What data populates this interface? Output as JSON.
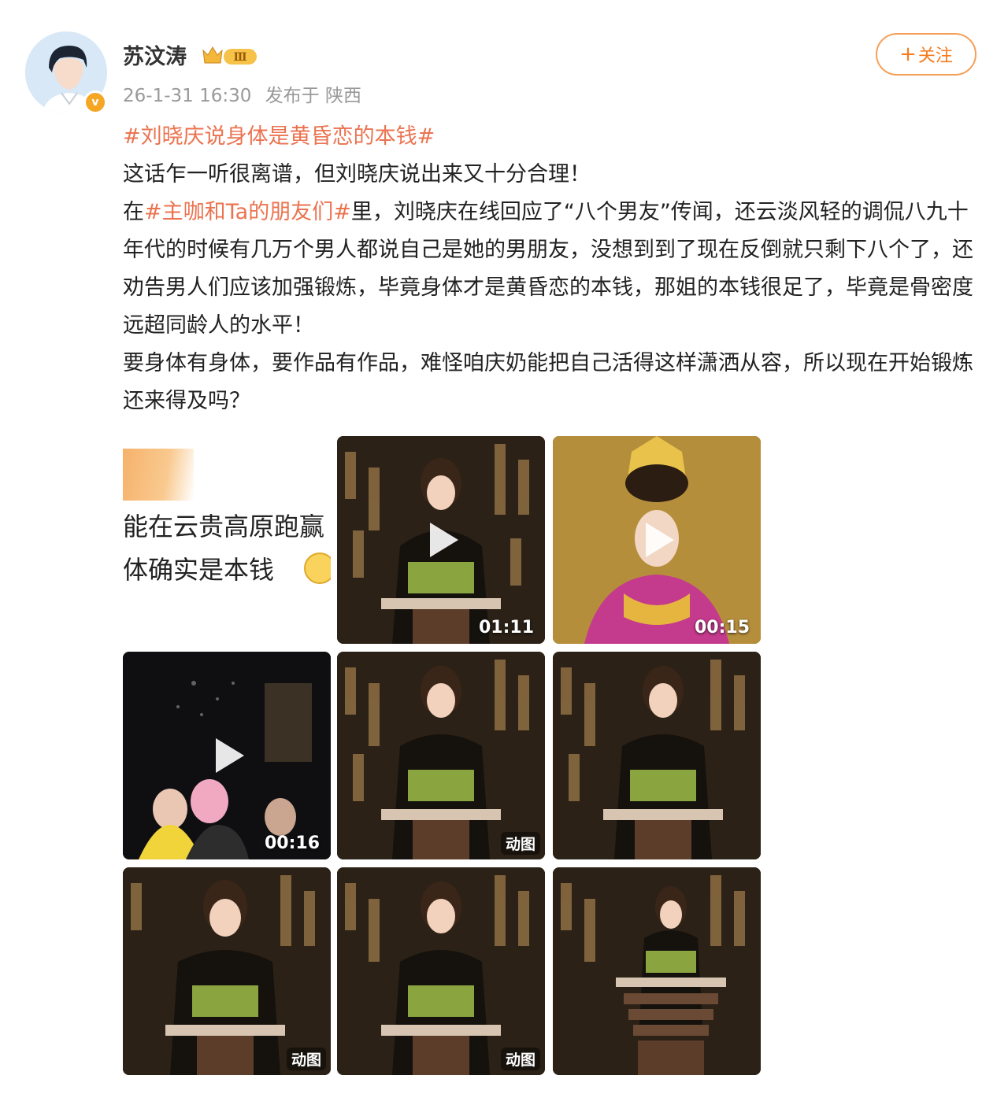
{
  "author": {
    "name": "苏汶涛",
    "level_badge": "Ⅲ",
    "verified_mark": "v",
    "timestamp": "26-1-31 16:30",
    "source": "发布于 陕西"
  },
  "follow_button": {
    "plus": "+",
    "label": "关注"
  },
  "post": {
    "topic_main": "#刘晓庆说身体是黄昏恋的本钱#",
    "line1": "这话乍一听很离谱，但刘晓庆说出来又十分合理！",
    "para2_prefix": "在",
    "topic_inline": "#主咖和Ta的朋友们#",
    "para2_rest": "里，刘晓庆在线回应了“八个男友”传闻，还云淡风轻的调侃八九十年代的时候有几万个男人都说自己是她的男朋友，没想到到了现在反倒就只剩下八个了，还劝告男人们应该加强锻炼，毕竟身体才是黄昏恋的本钱，那姐的本钱很足了，毕竟是骨密度远超同龄人的水平！",
    "para3": "要身体有身体，要作品有作品，难怪咱庆奶能把自己活得这样潇洒从容，所以现在开始锻炼还来得及吗？"
  },
  "media": {
    "text_image": {
      "line1": "能在云贵高原跑赢",
      "line2": "体确实是本钱"
    },
    "items": [
      {
        "kind": "text-image"
      },
      {
        "kind": "video",
        "duration": "01:11"
      },
      {
        "kind": "video",
        "duration": "00:15"
      },
      {
        "kind": "video",
        "duration": "00:16"
      },
      {
        "kind": "gif",
        "badge": "动图"
      },
      {
        "kind": "image"
      },
      {
        "kind": "gif",
        "badge": "动图"
      },
      {
        "kind": "gif",
        "badge": "动图"
      },
      {
        "kind": "image"
      }
    ]
  },
  "colors": {
    "topic": "#eb7350",
    "follow": "#f57c1e",
    "meta": "#999999"
  }
}
